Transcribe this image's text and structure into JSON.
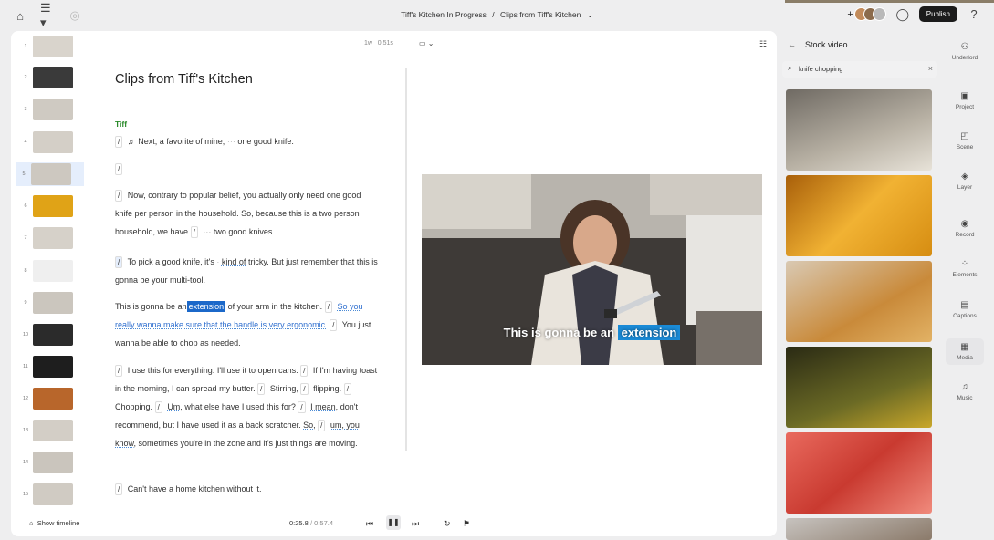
{
  "header": {
    "project": "Tiff's Kitchen In Progress",
    "separator": "/",
    "composition": "Clips from Tiff's Kitchen",
    "publish_label": "Publish"
  },
  "icons": {
    "home": "home-icon",
    "menu": "menu-icon",
    "sync": "sync-icon",
    "comment": "comment-icon",
    "help": "help-icon",
    "search": "search-icon",
    "close": "close-icon",
    "back": "back-arrow-icon"
  },
  "thumbnails": [
    "1",
    "2",
    "3",
    "4",
    "5",
    "6",
    "7",
    "8",
    "9",
    "10",
    "11",
    "12",
    "13",
    "14",
    "15"
  ],
  "editor": {
    "title": "Clips from Tiff's Kitchen",
    "speaker": "Tiff",
    "speed": "1w",
    "duration_hint": "0.51s",
    "paragraphs": {
      "p1": "Next, a favorite of mine,",
      "p1b": "one good knife.",
      "p3a": "Now, contrary to popular belief, you actually only need one good knife per person in the household. So, because this is a two person household, we have",
      "p3b": "two good knives",
      "p4a": "To pick a good knife, it's",
      "p4b": "kind of",
      "p4c": "tricky. But just remember that this is gonna be your multi-tool.",
      "p5a": "This is gonna be",
      "p5b": "an",
      "p5c": "extension",
      "p5d": "of your arm in the kitchen.",
      "p5e": "So you really wanna make sure that the handle is very ergonomic.",
      "p5f": "You just wanna be able to chop as needed.",
      "p6a": "I use this for everything.",
      "p6b": "I'll use it to open cans.",
      "p6c": "If I'm having toast in the morning, I can spread my butter.",
      "p6d": "Stirring,",
      "p6e": "flipping.",
      "p6f": "Chopping.",
      "p6g": "Um,",
      "p6h": "what else have I used this for?",
      "p6i": "I mean,",
      "p6j": "don't recommend, but I have used it as a back scratcher.",
      "p6k": "So,",
      "p6l": "um, you know,",
      "p6m": "sometimes you're in the zone and it's just things are moving.",
      "p7": "Can't have a home kitchen without it."
    }
  },
  "preview": {
    "caption_plain": "This is gonna be  an",
    "caption_highlight": "extension"
  },
  "player": {
    "show_timeline": "Show timeline",
    "current_time": "0:25.8",
    "time_sep": "/",
    "total_time": "0:57.4"
  },
  "stock": {
    "title": "Stock video",
    "search_value": "knife chopping"
  },
  "tools": [
    {
      "label": "Underlord",
      "icon": "underlord-icon"
    },
    {
      "label": "Project",
      "icon": "folder-icon"
    },
    {
      "label": "Scene",
      "icon": "scene-icon"
    },
    {
      "label": "Layer",
      "icon": "layers-icon"
    },
    {
      "label": "Record",
      "icon": "record-icon"
    },
    {
      "label": "Elements",
      "icon": "elements-icon"
    },
    {
      "label": "Captions",
      "icon": "captions-icon"
    },
    {
      "label": "Media",
      "icon": "media-icon"
    },
    {
      "label": "Music",
      "icon": "music-icon"
    }
  ]
}
